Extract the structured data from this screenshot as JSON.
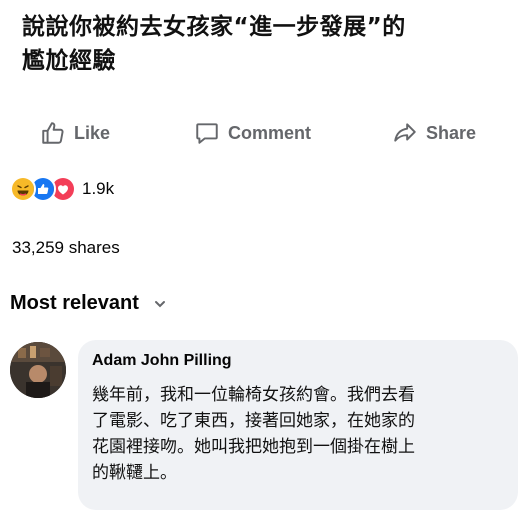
{
  "post": {
    "title": "說說你被約去女孩家“進一步發展”的\n尷尬經驗"
  },
  "actions": {
    "like_label": "Like",
    "comment_label": "Comment",
    "share_label": "Share"
  },
  "reactions": {
    "icons": [
      "haha-icon",
      "like-icon",
      "love-icon"
    ],
    "count": "1.9k"
  },
  "shares": "33,259 shares",
  "comments_sort": {
    "label": "Most relevant"
  },
  "comment": {
    "author": "Adam John Pilling",
    "text": "幾年前，我和一位輪椅女孩約會。我們去看\n了電影、吃了東西，接著回她家，在她家的\n花園裡接吻。她叫我把她抱到一個掛在樹上\n的鞦韆上。"
  },
  "colors": {
    "action_gray": "#65676b",
    "bubble_bg": "#f0f2f5",
    "like_blue": "#1877f2",
    "love_red": "#f33e58",
    "haha_yellow": "#f7b928"
  }
}
